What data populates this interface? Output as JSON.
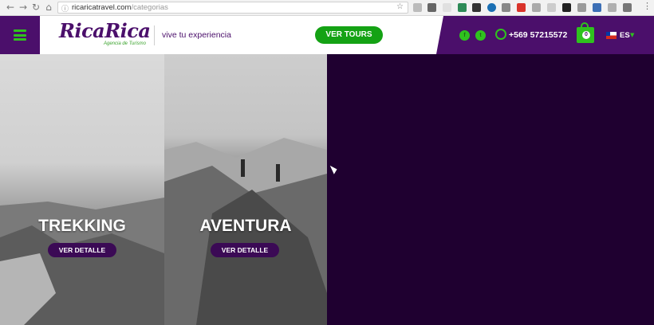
{
  "browser": {
    "url_host": "ricaricatravel.com",
    "url_path": "/categorias",
    "nav_icons": [
      "back-icon",
      "forward-icon",
      "reload-icon",
      "home-icon"
    ]
  },
  "header": {
    "logo_text": "RicaRica",
    "logo_subtitle": "Agencia de Turismo",
    "tagline": "vive tu experiencia",
    "cta_label": "VER TOURS",
    "phone": "+569 57215572",
    "cart_count": "0",
    "language": "ES",
    "colors": {
      "brand_purple": "#4b0f6b",
      "accent_green": "#2fc21e",
      "button_green": "#14a214"
    }
  },
  "tiles": [
    {
      "title": "TREKKING",
      "button_label": "VER DETALLE"
    },
    {
      "title": "AVENTURA",
      "button_label": "VER DETALLE"
    }
  ]
}
